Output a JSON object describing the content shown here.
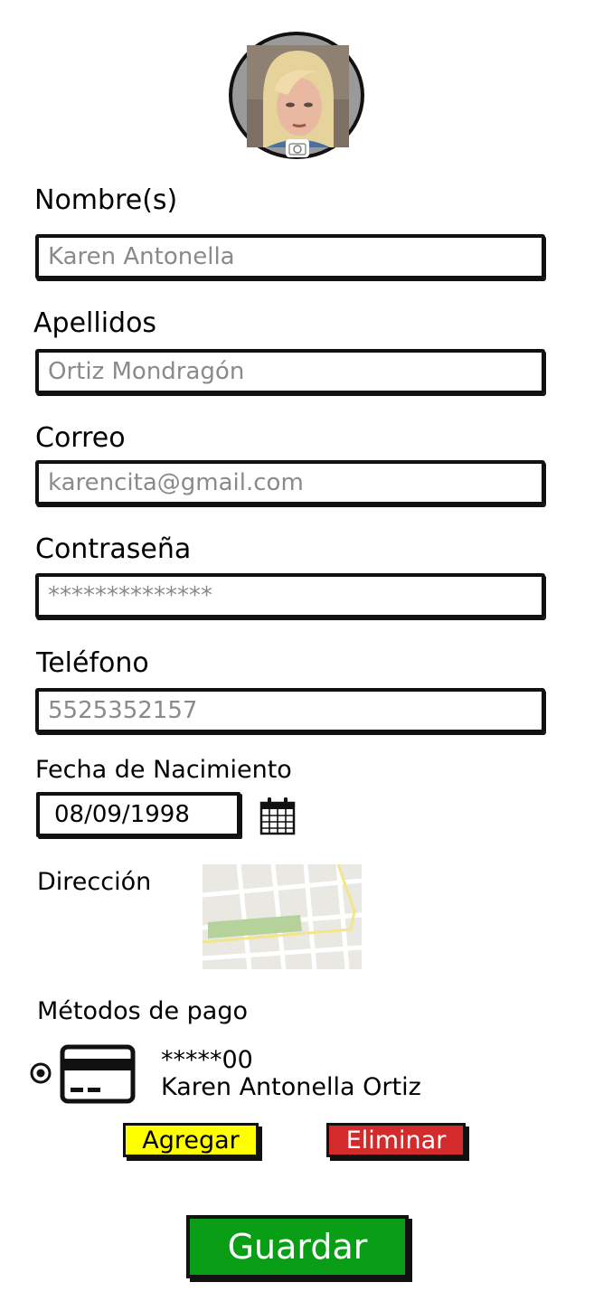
{
  "form": {
    "nombre": {
      "label": "Nombre(s)",
      "value": "Karen Antonella"
    },
    "apellidos": {
      "label": "Apellidos",
      "value": "Ortiz Mondragón"
    },
    "correo": {
      "label": "Correo",
      "value": "karencita@gmail.com"
    },
    "contrasena": {
      "label": "Contraseña",
      "value": "**************"
    },
    "telefono": {
      "label": "Teléfono",
      "value": "5525352157"
    },
    "fecha": {
      "label": "Fecha de Nacimiento",
      "value": "08/09/1998"
    },
    "direccion": {
      "label": "Dirección"
    }
  },
  "payment": {
    "label": "Métodos de pago",
    "card_number": "*****00",
    "card_holder": "Karen Antonella Ortiz",
    "add_label": "Agregar",
    "delete_label": "Eliminar"
  },
  "save_label": "Guardar",
  "colors": {
    "add": "#ffff00",
    "delete": "#d32b2b",
    "save": "#0a9e16",
    "map_path": "#b5d29a"
  }
}
